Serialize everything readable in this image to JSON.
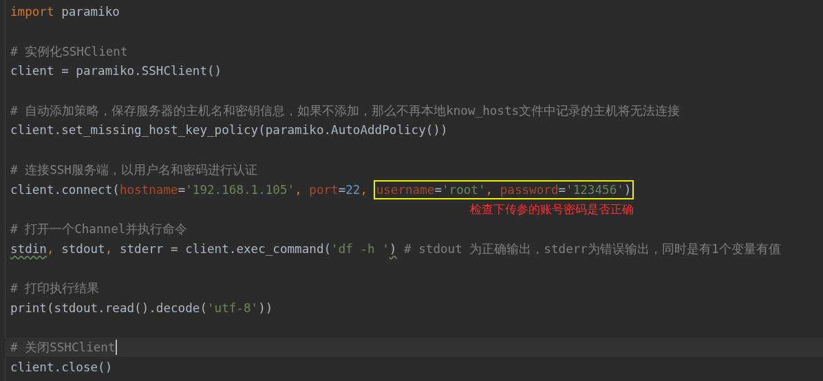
{
  "editor": {
    "lines": [
      {
        "current": false,
        "tokens": [
          {
            "kind": "keyword",
            "text": "import"
          },
          {
            "kind": "plain",
            "text": " paramiko"
          }
        ]
      },
      {
        "current": false
      },
      {
        "current": false,
        "tokens": [
          {
            "kind": "comment",
            "text": "# 实例化SSHClient"
          }
        ]
      },
      {
        "current": false,
        "tokens": [
          {
            "kind": "plain",
            "text": "client = paramiko.SSHClient()"
          }
        ]
      },
      {
        "current": false
      },
      {
        "current": false,
        "tokens": [
          {
            "kind": "comment",
            "text": "# 自动添加策略，保存服务器的主机名和密钥信息，如果不添加，那么不再本地know_hosts文件中记录的主机将无法连接"
          }
        ]
      },
      {
        "current": false,
        "tokens": [
          {
            "kind": "plain",
            "text": "client.set_missing_host_key_policy(paramiko.AutoAddPolicy())"
          }
        ]
      },
      {
        "current": false
      },
      {
        "current": false,
        "tokens": [
          {
            "kind": "comment",
            "text": "# 连接SSH服务端，以用户名和密码进行认证"
          }
        ]
      },
      {
        "current": false,
        "tokens": [
          {
            "kind": "plain",
            "text": "client.connect("
          },
          {
            "kind": "param",
            "text": "hostname"
          },
          {
            "kind": "plain",
            "text": "="
          },
          {
            "kind": "string",
            "text": "'192.168.1.105'"
          },
          {
            "kind": "keyword",
            "text": ", "
          },
          {
            "kind": "param",
            "text": "port"
          },
          {
            "kind": "plain",
            "text": "="
          },
          {
            "kind": "number",
            "text": "22"
          },
          {
            "kind": "keyword",
            "text": ", "
          },
          {
            "kind": "group",
            "highlighted": true,
            "tokens": [
              {
                "kind": "param",
                "text": "username"
              },
              {
                "kind": "plain",
                "text": "="
              },
              {
                "kind": "string",
                "text": "'root'"
              },
              {
                "kind": "keyword",
                "text": ", "
              },
              {
                "kind": "param",
                "text": "password"
              },
              {
                "kind": "plain",
                "text": "="
              },
              {
                "kind": "string",
                "text": "'123456'"
              },
              {
                "kind": "plain",
                "text": ")"
              }
            ]
          }
        ]
      },
      {
        "current": false,
        "note": "检查下传参的账号密码是否正确"
      },
      {
        "current": false,
        "tokens": [
          {
            "kind": "comment",
            "text": "# 打开一个Channel并执行命令"
          }
        ]
      },
      {
        "current": false,
        "tokens": [
          {
            "kind": "plain",
            "text": "stdin",
            "warning": true
          },
          {
            "kind": "keyword",
            "text": ", "
          },
          {
            "kind": "plain",
            "text": "stdout"
          },
          {
            "kind": "keyword",
            "text": ", "
          },
          {
            "kind": "plain",
            "text": "stderr = client.exec_command("
          },
          {
            "kind": "string",
            "text": "'df -h '"
          },
          {
            "kind": "plain",
            "text": ")",
            "warning": true
          },
          {
            "kind": "comment",
            "text": " # stdout 为正确输出，stderr为错误输出，同时是有1个变量有值"
          }
        ]
      },
      {
        "current": false
      },
      {
        "current": false,
        "tokens": [
          {
            "kind": "comment",
            "text": "# 打印执行结果"
          }
        ]
      },
      {
        "current": false,
        "tokens": [
          {
            "kind": "plain",
            "text": "print(stdout.read().decode("
          },
          {
            "kind": "string",
            "text": "'utf-8'"
          },
          {
            "kind": "plain",
            "text": "))"
          }
        ]
      },
      {
        "current": false
      },
      {
        "current": true,
        "tokens": [
          {
            "kind": "comment",
            "text": "# 关闭SSHClient"
          }
        ]
      },
      {
        "current": false,
        "tokens": [
          {
            "kind": "plain",
            "text": "client.close()"
          }
        ]
      }
    ]
  }
}
